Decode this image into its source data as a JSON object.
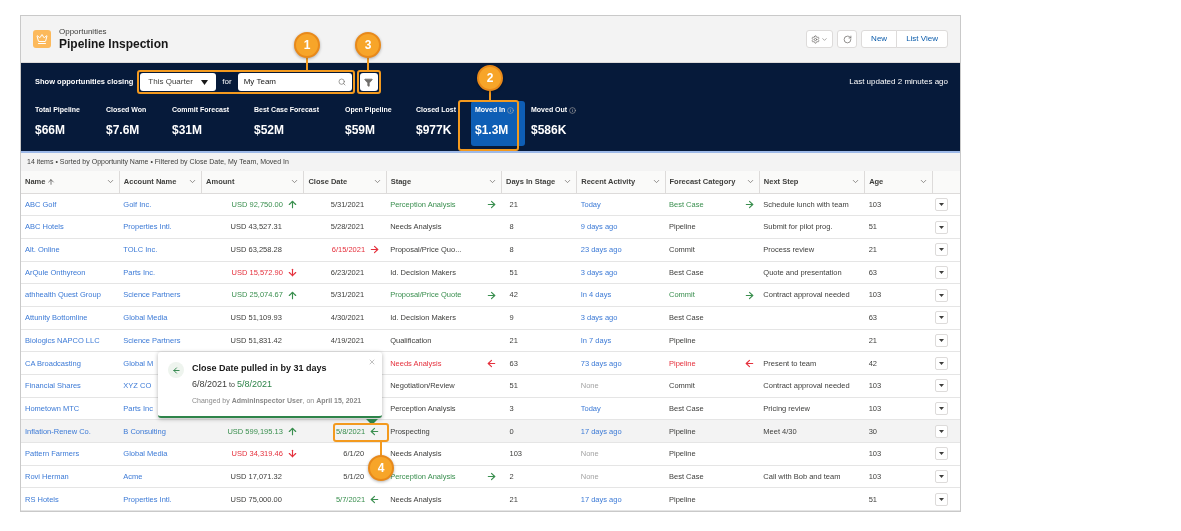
{
  "header": {
    "object": "Opportunities",
    "title": "Pipeline Inspection",
    "buttons": [
      "New",
      "List View"
    ]
  },
  "filter_bar": {
    "label": "Show opportunities closing",
    "period": "This Quarter",
    "connector": "for",
    "scope": "My Team",
    "last_updated": "Last updated 2 minutes ago"
  },
  "metrics": [
    {
      "label": "Total Pipeline",
      "value": "$66M",
      "selected": false,
      "info": false
    },
    {
      "label": "Closed Won",
      "value": "$7.6M",
      "selected": false,
      "info": false
    },
    {
      "label": "Commit Forecast",
      "value": "$31M",
      "selected": false,
      "info": false
    },
    {
      "label": "Best Case Forecast",
      "value": "$52M",
      "selected": false,
      "info": false
    },
    {
      "label": "Open Pipeline",
      "value": "$59M",
      "selected": false,
      "info": false
    },
    {
      "label": "Closed Lost",
      "value": "$977K",
      "selected": false,
      "info": false
    },
    {
      "label": "Moved In",
      "value": "$1.3M",
      "selected": true,
      "info": true
    },
    {
      "label": "Moved Out",
      "value": "$586K",
      "selected": false,
      "info": true
    }
  ],
  "summary": "14 items • Sorted by Opportunity Name • Filtered by Close Date, My Team, Moved In",
  "table": {
    "columns": [
      {
        "label": "Name",
        "sorted": true
      },
      {
        "label": "Account Name",
        "sorted": false
      },
      {
        "label": "Amount",
        "sorted": false
      },
      {
        "label": "Close Date",
        "sorted": false
      },
      {
        "label": "Stage",
        "sorted": false
      },
      {
        "label": "Days In Stage",
        "sorted": false
      },
      {
        "label": "Recent Activity",
        "sorted": false
      },
      {
        "label": "Forecast Category",
        "sorted": false
      },
      {
        "label": "Next Step",
        "sorted": false
      },
      {
        "label": "Age",
        "sorted": false
      }
    ],
    "rows": [
      {
        "selected": false,
        "name": "ABC Golf",
        "account": "Golf Inc.",
        "amount": {
          "text": "USD 92,750.00",
          "kind": "up"
        },
        "close_date": {
          "text": "5/31/2021",
          "kind": "plain"
        },
        "stage": {
          "text": "Perception Analysis",
          "kind": "advanced"
        },
        "days_in_stage": "21",
        "recent_activity": {
          "text": "Today",
          "kind": "link"
        },
        "forecast_category": {
          "text": "Best Case",
          "kind": "advanced"
        },
        "next_step": "Schedule lunch with team",
        "age": "103"
      },
      {
        "selected": false,
        "name": "ABC Hotels",
        "account": "Properties Intl.",
        "amount": {
          "text": "USD 43,527.31",
          "kind": "plain"
        },
        "close_date": {
          "text": "5/28/2021",
          "kind": "plain"
        },
        "stage": {
          "text": "Needs Analysis",
          "kind": "plain"
        },
        "days_in_stage": "8",
        "recent_activity": {
          "text": "9 days ago",
          "kind": "link"
        },
        "forecast_category": {
          "text": "Pipeline",
          "kind": "plain"
        },
        "next_step": "Submit for pilot prog.",
        "age": "51"
      },
      {
        "selected": false,
        "name": "Alt. Online",
        "account": "TOLC Inc.",
        "amount": {
          "text": "USD 63,258.28",
          "kind": "plain"
        },
        "close_date": {
          "text": "6/15/2021",
          "kind": "pushed"
        },
        "stage": {
          "text": "Proposal/Price Quo...",
          "kind": "plain"
        },
        "days_in_stage": "8",
        "recent_activity": {
          "text": "23 days ago",
          "kind": "link"
        },
        "forecast_category": {
          "text": "Commit",
          "kind": "plain"
        },
        "next_step": "Process review",
        "age": "21"
      },
      {
        "selected": false,
        "name": "ArQule Onthyreon",
        "account": "Parts Inc.",
        "amount": {
          "text": "USD 15,572.90",
          "kind": "down"
        },
        "close_date": {
          "text": "6/23/2021",
          "kind": "plain"
        },
        "stage": {
          "text": "Id. Decision Makers",
          "kind": "plain"
        },
        "days_in_stage": "51",
        "recent_activity": {
          "text": "3 days ago",
          "kind": "link"
        },
        "forecast_category": {
          "text": "Best Case",
          "kind": "plain"
        },
        "next_step": "Quote and presentation",
        "age": "63"
      },
      {
        "selected": false,
        "name": "athhealth Quest Group",
        "account": "Science Partners",
        "amount": {
          "text": "USD 25,074.67",
          "kind": "up"
        },
        "close_date": {
          "text": "5/31/2021",
          "kind": "plain"
        },
        "stage": {
          "text": "Proposal/Price Quote",
          "kind": "advanced"
        },
        "days_in_stage": "42",
        "recent_activity": {
          "text": "In 4 days",
          "kind": "link"
        },
        "forecast_category": {
          "text": "Commit",
          "kind": "advanced"
        },
        "next_step": "Contract approval needed",
        "age": "103"
      },
      {
        "selected": false,
        "name": "Attunity Bottomline",
        "account": "Global Media",
        "amount": {
          "text": "USD 51,109.93",
          "kind": "plain"
        },
        "close_date": {
          "text": "4/30/2021",
          "kind": "plain"
        },
        "stage": {
          "text": "Id. Decision Makers",
          "kind": "plain"
        },
        "days_in_stage": "9",
        "recent_activity": {
          "text": "3 days ago",
          "kind": "link"
        },
        "forecast_category": {
          "text": "Best Case",
          "kind": "plain"
        },
        "age": "63"
      },
      {
        "selected": false,
        "name": "Biologics NAPCO LLC",
        "account": "Science Partners",
        "amount": {
          "text": "USD 51,831.42",
          "kind": "plain"
        },
        "close_date": {
          "text": "4/19/2021",
          "kind": "plain"
        },
        "stage": {
          "text": "Qualification",
          "kind": "plain"
        },
        "days_in_stage": "21",
        "recent_activity": {
          "text": "In 7 days",
          "kind": "link"
        },
        "forecast_category": {
          "text": "Pipeline",
          "kind": "plain"
        },
        "age": "21"
      },
      {
        "selected": false,
        "name": "CA Broadcasting",
        "account": "Global M",
        "stage": {
          "text": "Needs Analysis",
          "kind": "regressed"
        },
        "days_in_stage": "63",
        "recent_activity": {
          "text": "73 days ago",
          "kind": "link"
        },
        "forecast_category": {
          "text": "Pipeline",
          "kind": "regressed"
        },
        "next_step": "Present to team",
        "age": "42"
      },
      {
        "selected": false,
        "name": "Financial Shares",
        "account": "XYZ CO",
        "stage": {
          "text": "Negotiation/Review",
          "kind": "plain"
        },
        "days_in_stage": "51",
        "recent_activity": {
          "text": "None",
          "kind": "empty"
        },
        "forecast_category": {
          "text": "Commit",
          "kind": "plain"
        },
        "next_step": "Contract approval needed",
        "age": "103"
      },
      {
        "selected": false,
        "name": "Hometown MTC",
        "account": "Parts Inc",
        "stage": {
          "text": "Perception Analysis",
          "kind": "plain"
        },
        "days_in_stage": "3",
        "recent_activity": {
          "text": "Today",
          "kind": "link"
        },
        "forecast_category": {
          "text": "Best Case",
          "kind": "plain"
        },
        "next_step": "Pricing review",
        "age": "103"
      },
      {
        "selected": true,
        "name": "Inflation-Renew Co.",
        "account": "B Consulting",
        "amount": {
          "text": "USD 599,195.13",
          "kind": "up"
        },
        "close_date": {
          "text": "5/8/2021",
          "kind": "pulled"
        },
        "stage": {
          "text": "Prospecting",
          "kind": "plain"
        },
        "days_in_stage": "0",
        "recent_activity": {
          "text": "17 days ago",
          "kind": "link"
        },
        "forecast_category": {
          "text": "Pipeline",
          "kind": "plain"
        },
        "next_step": "Meet 4/30",
        "age": "30"
      },
      {
        "selected": false,
        "name": "Pattern Farmers",
        "account": "Global Media",
        "amount": {
          "text": "USD 34,319.46",
          "kind": "down"
        },
        "close_date": {
          "text": "6/1/20",
          "kind": "plain"
        },
        "stage": {
          "text": "Needs Analysis",
          "kind": "plain"
        },
        "days_in_stage": "103",
        "recent_activity": {
          "text": "None",
          "kind": "empty"
        },
        "forecast_category": {
          "text": "Pipeline",
          "kind": "plain"
        },
        "age": "103"
      },
      {
        "selected": false,
        "name": "Rovi Herman",
        "account": "Acme",
        "amount": {
          "text": "USD 17,071.32",
          "kind": "plain"
        },
        "close_date": {
          "text": "5/1/20",
          "kind": "plain"
        },
        "stage": {
          "text": "Perception Analysis",
          "kind": "advanced"
        },
        "days_in_stage": "2",
        "recent_activity": {
          "text": "None",
          "kind": "empty"
        },
        "forecast_category": {
          "text": "Best Case",
          "kind": "plain"
        },
        "next_step": "Call with Bob and team",
        "age": "103"
      },
      {
        "selected": false,
        "name": "RS Hotels",
        "account": "Properties Intl.",
        "amount": {
          "text": "USD 75,000.00",
          "kind": "plain"
        },
        "close_date": {
          "text": "5/7/2021",
          "kind": "pulled"
        },
        "stage": {
          "text": "Needs Analysis",
          "kind": "plain"
        },
        "days_in_stage": "21",
        "recent_activity": {
          "text": "17 days ago",
          "kind": "link"
        },
        "forecast_category": {
          "text": "Pipeline",
          "kind": "plain"
        },
        "age": "51"
      }
    ]
  },
  "popover": {
    "title": "Close Date pulled in by 31 days",
    "old_date": "6/8/2021",
    "separator": "to",
    "new_date": "5/8/2021",
    "changed_by": "Changed by **AdminInspector User**, on **April 15, 2021**"
  },
  "callouts": [
    {
      "number": "1"
    },
    {
      "number": "2"
    },
    {
      "number": "3"
    },
    {
      "number": "4"
    }
  ]
}
